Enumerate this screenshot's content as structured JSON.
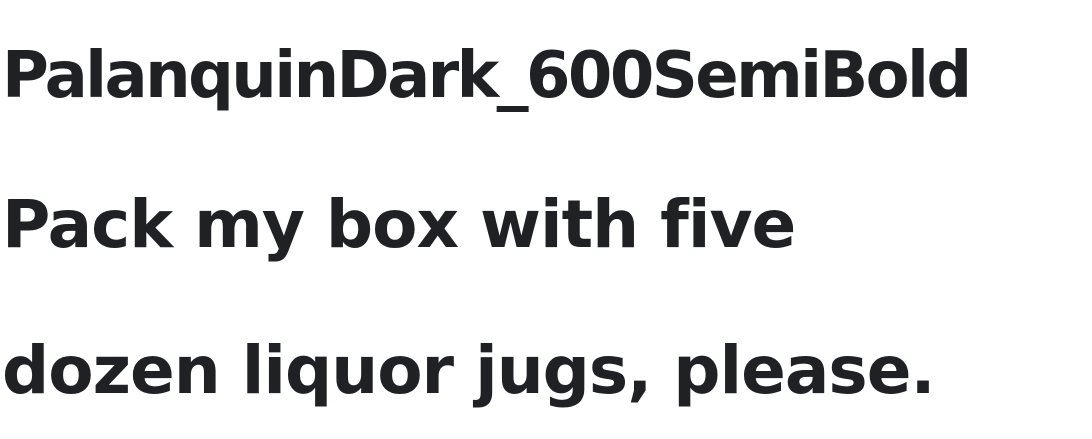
{
  "specimen": {
    "font_name": "PalanquinDark_600SemiBold",
    "sample_lines": [
      "Pack my box with five",
      "dozen liquor jugs, please."
    ],
    "text_color": "#1f2125",
    "background_color": "#ffffff"
  }
}
